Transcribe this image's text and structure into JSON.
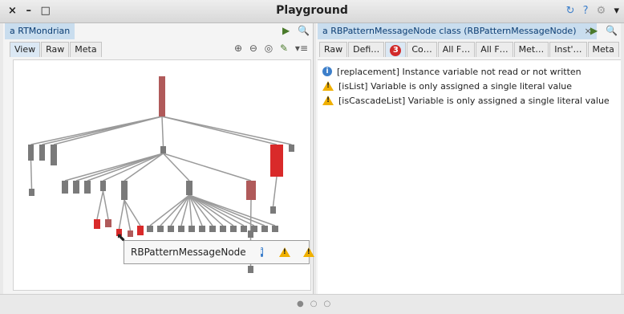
{
  "window": {
    "title": "Playground",
    "controls": [
      "×",
      "–",
      "□"
    ]
  },
  "left_pane": {
    "title": "a RTMondrian",
    "tabs": [
      "View",
      "Raw",
      "Meta"
    ],
    "selected_tab": "View"
  },
  "right_pane": {
    "title": "a RBPatternMessageNode class (RBPatternMessageNode)",
    "close": "×",
    "tabs": [
      "Raw",
      "Defi…",
      "3",
      "Co…",
      "All F…",
      "All F…",
      "Met…",
      "Inst'…",
      "Meta"
    ],
    "selected_tab": "3",
    "critiques": [
      {
        "icon": "info-icon",
        "text": "[replacement] Instance variable not read or not written"
      },
      {
        "icon": "warning-icon",
        "text": "[isList] Variable is only assigned a single literal value"
      },
      {
        "icon": "warning-icon",
        "text": "[isCascadeList] Variable is only assigned a single literal value"
      }
    ]
  },
  "tooltip": {
    "label": "RBPatternMessageNode",
    "icons": [
      "info-icon",
      "warning-icon",
      "warning-icon"
    ]
  },
  "colors": {
    "node_gray": "#7a7a7a",
    "node_red": "#d92a2a",
    "node_darkred": "#b05a5a",
    "edge": "#9a9a9a",
    "accent_tab": "#c9ddee"
  }
}
